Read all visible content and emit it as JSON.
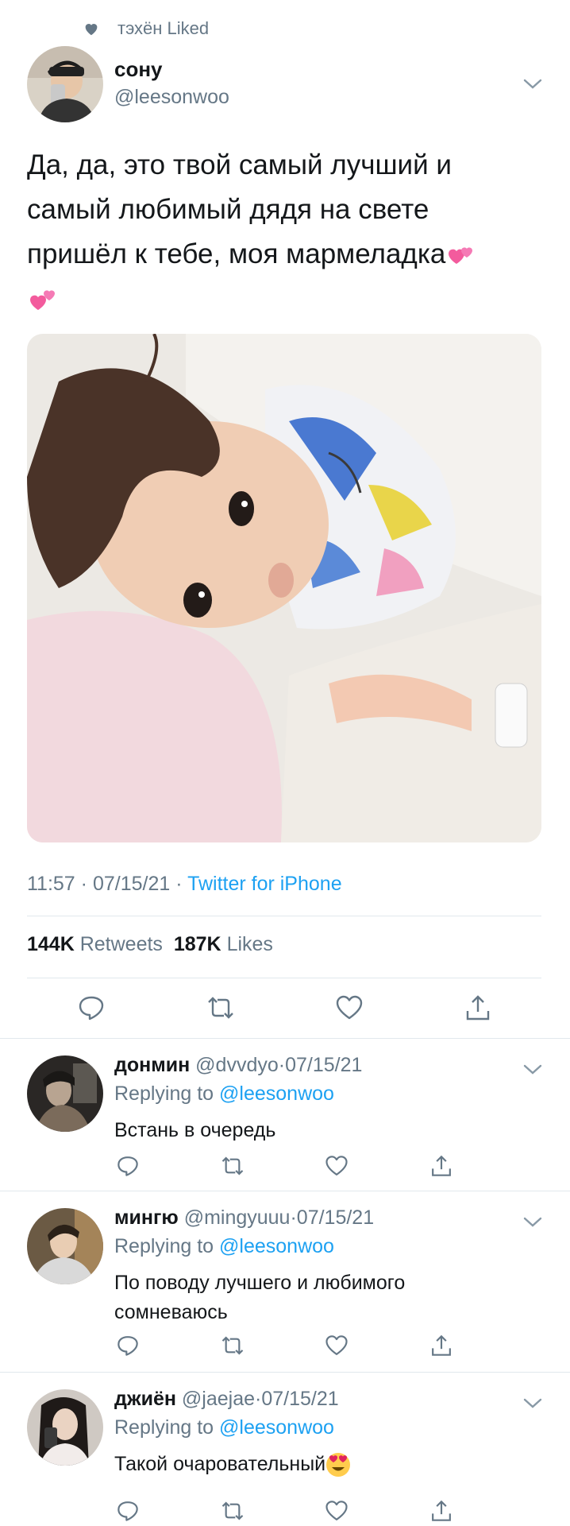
{
  "context": {
    "icon": "heart-icon",
    "text": "тэхён Liked"
  },
  "tweet": {
    "name": "сону",
    "handle": "@leesonwoo",
    "text": "Да, да, это твой самый лучший и самый любимый дядя на свете пришёл к тебе, моя мармеладка",
    "time": "11:57",
    "date": "07/15/21",
    "source": "Twitter for iPhone",
    "retweets": "144K",
    "retweets_label": "Retweets",
    "likes": "187K",
    "likes_label": "Likes"
  },
  "replies": [
    {
      "name": "донмин",
      "handle": "@dvvdyo",
      "date": "07/15/21",
      "replying": "Replying to",
      "mention": "@leesonwoo",
      "text": "Встань в очередь"
    },
    {
      "name": "мингю",
      "handle": "@mingyuuu",
      "date": "07/15/21",
      "replying": "Replying to",
      "mention": "@leesonwoo",
      "text": "По поводу лучшего и любимого сомневаюсь"
    },
    {
      "name": "джиён",
      "handle": "@jaejae",
      "date": "07/15/21",
      "replying": "Replying to",
      "mention": "@leesonwoo",
      "text": "Такой очаровательный"
    }
  ],
  "separator": "·",
  "colors": {
    "link": "#1da1f2",
    "secondary": "#657786",
    "divider": "#e1e8ed",
    "text": "#14171a"
  }
}
